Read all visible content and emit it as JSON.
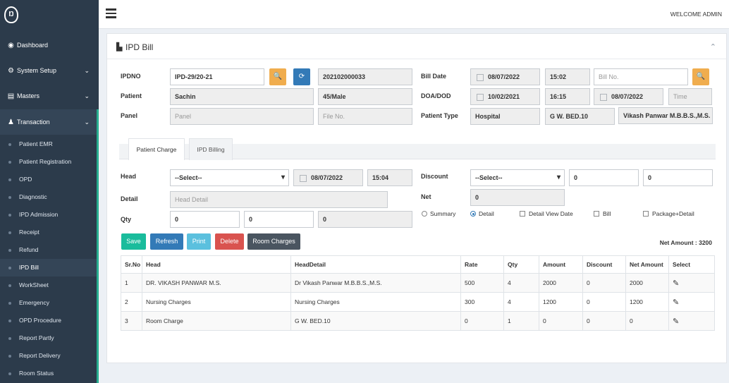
{
  "sidebar": {
    "items": [
      {
        "label": "Dashboard"
      },
      {
        "label": "System Setup"
      },
      {
        "label": "Masters"
      },
      {
        "label": "Transaction"
      }
    ],
    "sub_items": [
      "Patient EMR",
      "Patient Registration",
      "OPD",
      "Diagnostic",
      "IPD Admission",
      "Receipt",
      "Refund",
      "IPD Bill",
      "WorkSheet",
      "Emergency",
      "OPD Procedure",
      "Report Partly",
      "Report Delivery",
      "Room Status"
    ],
    "active_sub": "IPD Bill"
  },
  "header": {
    "welcome": "WELCOME ADMIN"
  },
  "panel": {
    "title": "IPD Bill"
  },
  "form": {
    "ipdno_label": "IPDNO",
    "ipdno": "IPD-29/20-21",
    "reg_no": "202102000033",
    "patient_label": "Patient",
    "patient": "Sachin",
    "age_sex": "45/Male",
    "panel_label": "Panel",
    "panel_ph": "Panel",
    "file_ph": "File No.",
    "bill_date_label": "Bill Date",
    "bill_date": "08/07/2022",
    "bill_time": "15:02",
    "bill_no_ph": "Bill No.",
    "doa_label": "DOA/DOD",
    "doa": "10/02/2021",
    "doa_time": "16:15",
    "dod": "08/07/2022",
    "time_ph": "Time",
    "ptype_label": "Patient Type",
    "ptype": "Hospital",
    "bed": "G W. BED.10",
    "doctor": "Vikash Panwar M.B.B.S.,M.S."
  },
  "tabs": [
    "Patient Charge",
    "IPD Billing"
  ],
  "charge": {
    "head_label": "Head",
    "head_select": "--Select--",
    "date": "08/07/2022",
    "time": "15:04",
    "detail_label": "Detail",
    "detail_ph": "Head Detail",
    "qty_label": "Qty",
    "qty1": "0",
    "qty2": "0",
    "qty3": "0",
    "discount_label": "Discount",
    "discount_select": "--Select--",
    "disc1": "0",
    "disc2": "0",
    "net_label": "Net",
    "net": "0",
    "radios": [
      "Summary",
      "Detail"
    ],
    "checks": [
      "Detail View Date",
      "Bill",
      "Package+Detail"
    ]
  },
  "actions": {
    "save": "Save",
    "refresh": "Refresh",
    "print": "Print",
    "delete": "Delete",
    "room": "Room Charges"
  },
  "net_amount": "Net Amount : 3200",
  "table": {
    "headers": [
      "Sr.No",
      "Head",
      "HeadDetail",
      "Rate",
      "Qty",
      "Amount",
      "Discount",
      "Net Amount",
      "Select"
    ],
    "rows": [
      [
        "1",
        "DR. VIKASH PANWAR M.S.",
        "Dr Vikash Panwar M.B.B.S.,M.S.",
        "500",
        "4",
        "2000",
        "0",
        "2000"
      ],
      [
        "2",
        "Nursing Charges",
        "Nursing Charges",
        "300",
        "4",
        "1200",
        "0",
        "1200"
      ],
      [
        "3",
        "Room Charge",
        "G W. BED.10",
        "0",
        "1",
        "0",
        "0",
        "0"
      ]
    ]
  },
  "colors": {
    "sidebar": "#2c3b4b",
    "accent": "#27ae8f",
    "save": "#1abc9c",
    "refresh": "#337ab7",
    "print": "#5bc0de",
    "delete": "#d9534f",
    "room": "#4a5560"
  }
}
